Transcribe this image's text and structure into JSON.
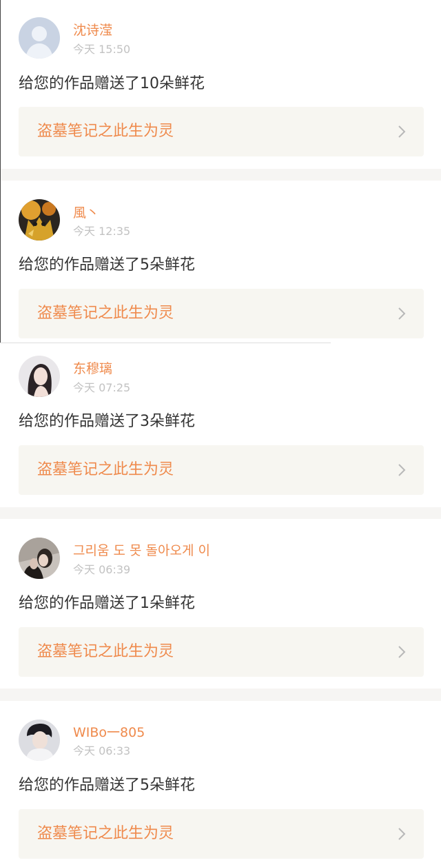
{
  "gift_feed": {
    "work_link_label": "盗墓笔记之此生为灵",
    "items": [
      {
        "username": "沈诗滢",
        "time": "今天 15:50",
        "message": "给您的作品赠送了10朵鲜花",
        "work_title": "盗墓笔记之此生为灵",
        "avatar": "default-avatar-icon"
      },
      {
        "username": "風丶",
        "time": "今天 12:35",
        "message": "给您的作品赠送了5朵鲜花",
        "work_title": "盗墓笔记之此生为灵",
        "avatar": "anime-character-avatar"
      },
      {
        "username": "东穆璃",
        "time": "今天 07:25",
        "message": "给您的作品赠送了3朵鲜花",
        "work_title": "盗墓笔记之此生为灵",
        "avatar": "girl-portrait-avatar"
      },
      {
        "username": "그리움 도 못 돌아오게 이",
        "time": "今天 06:39",
        "message": "给您的作品赠送了1朵鲜花",
        "work_title": "盗墓笔记之此生为灵",
        "avatar": "couple-portrait-avatar"
      },
      {
        "username": "WIBo一805",
        "time": "今天 06:33",
        "message": "给您的作品赠送了5朵鲜花",
        "work_title": "盗墓笔记之此生为灵",
        "avatar": "man-portrait-avatar"
      }
    ]
  },
  "colors": {
    "accent": "#ef8a4c",
    "time_text": "#c2c2c2",
    "message_text": "#333333",
    "link_background": "#f7f6f1",
    "separator": "#f6f5f3"
  }
}
